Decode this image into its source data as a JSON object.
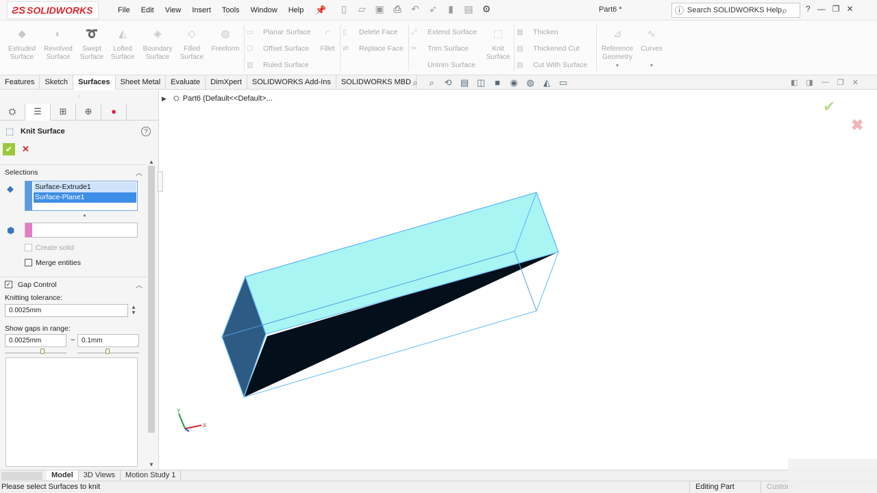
{
  "app": {
    "logo": "SOLIDWORKS",
    "doc_title": "Part6 *",
    "search_placeholder": "Search SOLIDWORKS Help"
  },
  "menu": [
    "File",
    "Edit",
    "View",
    "Insert",
    "Tools",
    "Window",
    "Help"
  ],
  "ribbon": {
    "big_buttons": [
      {
        "label": "Extruded Surface",
        "icon": "extruded-surface-icon"
      },
      {
        "label": "Revolved Surface",
        "icon": "revolved-surface-icon"
      },
      {
        "label": "Swept Surface",
        "icon": "swept-surface-icon"
      },
      {
        "label": "Lofted Surface",
        "icon": "lofted-surface-icon"
      },
      {
        "label": "Boundary Surface",
        "icon": "boundary-surface-icon"
      },
      {
        "label": "Filled Surface",
        "icon": "filled-surface-icon"
      },
      {
        "label": "Freeform",
        "icon": "freeform-icon"
      }
    ],
    "group1": [
      "Planar Surface",
      "Offset Surface",
      "Ruled Surface"
    ],
    "fillet": "Fillet",
    "group2": [
      "Delete Face",
      "Replace Face"
    ],
    "group3": [
      "Extend Surface",
      "Trim Surface",
      "Untrim Surface"
    ],
    "knit_surface": "Knit Surface",
    "group4": [
      "Thicken",
      "Thickened Cut",
      "Cut With Surface"
    ],
    "reference_geometry": "Reference Geometry",
    "curves": "Curves"
  },
  "tabs": [
    "Features",
    "Sketch",
    "Surfaces",
    "Sheet Metal",
    "Evaluate",
    "DimXpert",
    "SOLIDWORKS Add-Ins",
    "SOLIDWORKS MBD"
  ],
  "active_tab": "Surfaces",
  "property_manager": {
    "title": "Knit Surface",
    "selections_label": "Selections",
    "selections": [
      "Surface-Extrude1",
      "Surface-Plane1"
    ],
    "create_solid": "Create solid",
    "merge_entities": "Merge entities",
    "gap_control_label": "Gap Control",
    "knitting_tolerance_label": "Knitting tolerance:",
    "knitting_tolerance": "0.0025mm",
    "show_gaps_label": "Show gaps in range:",
    "gap_min": "0.0025mm",
    "range_separator": "~",
    "gap_max": "0.1mm"
  },
  "tree": {
    "part_node": "Part6  (Default<<Default>..."
  },
  "bottom_tabs": [
    "Model",
    "3D Views",
    "Motion Study 1"
  ],
  "active_bottom_tab": "Model",
  "status": {
    "message": "Please select Surfaces to knit",
    "mode": "Editing Part",
    "units": "Custom"
  },
  "colors": {
    "brand": "#d8262e",
    "selection": "#3d8ee6",
    "surface_top": "#a8f5f3",
    "surface_dark": "#03101b",
    "surface_side": "#2d5b84",
    "ok_green": "#9ac93a",
    "cancel_red": "#d6282c"
  }
}
